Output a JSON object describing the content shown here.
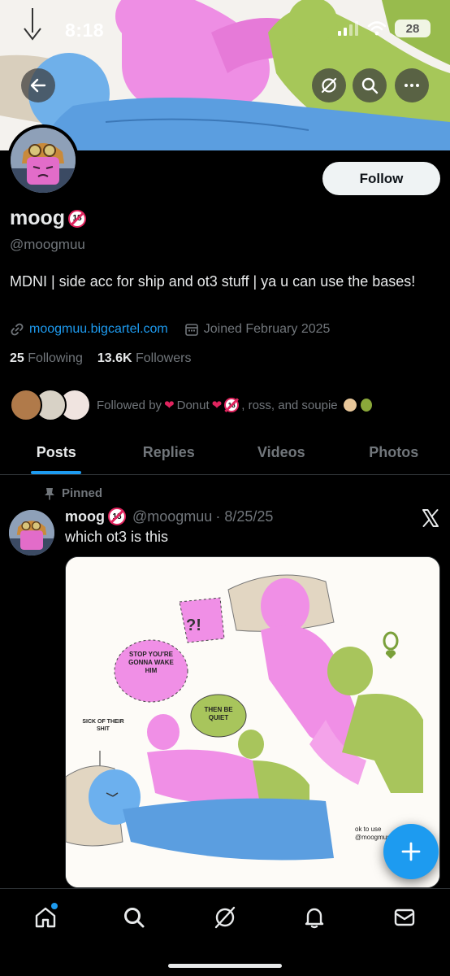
{
  "status_bar": {
    "time": "8:18",
    "battery": "28"
  },
  "banner": {
    "back_icon": "arrow-left-icon",
    "grok_icon": "grok-icon",
    "search_icon": "search-icon",
    "more_icon": "more-horizontal-icon"
  },
  "profile": {
    "display_name": "moog",
    "handle": "@moogmuu",
    "follow_label": "Follow",
    "bio": "MDNI | side acc for ship and ot3 stuff | ya u can use the bases!",
    "website": "moogmuu.bigcartel.com",
    "joined": "Joined February 2025",
    "following_count": "25",
    "following_label": "Following",
    "followers_count": "13.6K",
    "followers_label": "Followers",
    "followed_by_prefix": "Followed by",
    "followed_by_name1": "Donut",
    "followed_by_rest": ", ross, and soupie"
  },
  "tabs": [
    {
      "label": "Posts",
      "active": true
    },
    {
      "label": "Replies",
      "active": false
    },
    {
      "label": "Videos",
      "active": false
    },
    {
      "label": "Photos",
      "active": false
    }
  ],
  "post": {
    "pinned_label": "Pinned",
    "author_name": "moog",
    "author_handle": "@moogmuu",
    "date": "· 8/25/25",
    "text": "which ot3 is this",
    "media": {
      "bubble_1": "STOP YOU'RE GONNA WAKE HIM",
      "bubble_2": "THEN BE QUIET",
      "bubble_3": "?!",
      "note": "SICK OF THEIR SHIT",
      "signature": "ok to use @moogmuu"
    }
  },
  "bottom_nav": [
    "home-icon",
    "search-icon",
    "grok-icon",
    "notifications-icon",
    "messages-icon"
  ],
  "colors": {
    "accent": "#1d9bf0",
    "background": "#000000",
    "secondary_text": "#71767b"
  }
}
